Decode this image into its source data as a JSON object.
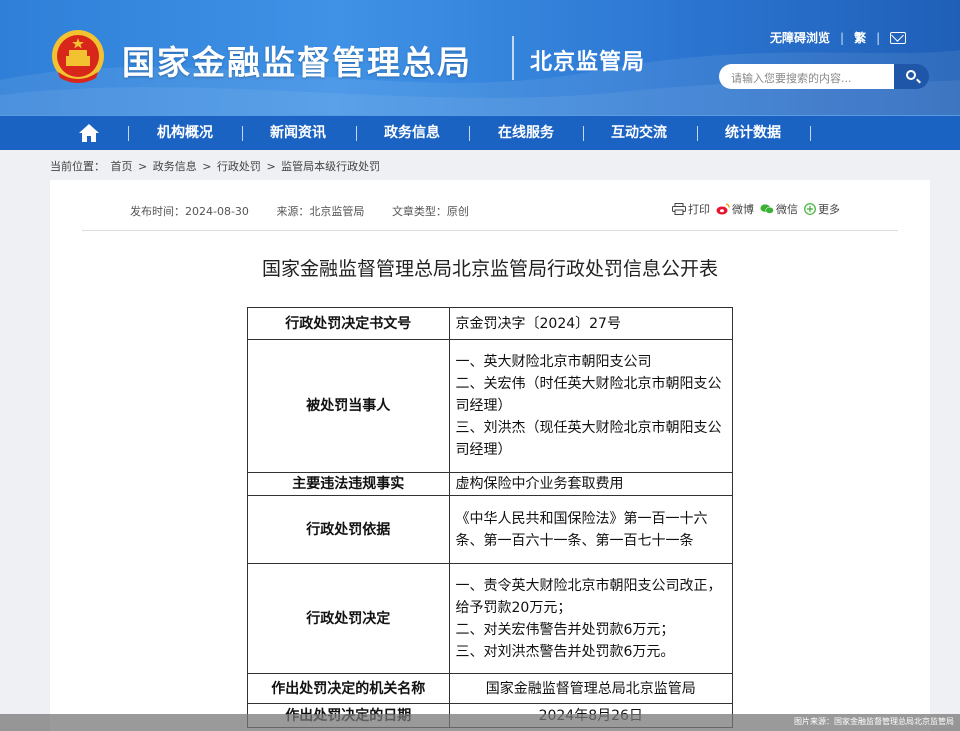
{
  "header": {
    "site_title": "国家金融监督管理总局",
    "branch_title": "北京监管局",
    "accessibility": "无障碍浏览",
    "traditional": "繁",
    "search_placeholder": "请输入您要搜索的内容..."
  },
  "nav": {
    "items": [
      {
        "label": "机构概况"
      },
      {
        "label": "新闻资讯"
      },
      {
        "label": "政务信息"
      },
      {
        "label": "在线服务"
      },
      {
        "label": "互动交流"
      },
      {
        "label": "统计数据"
      }
    ]
  },
  "breadcrumb": {
    "prefix": "当前位置：",
    "items": [
      "首页",
      "政务信息",
      "行政处罚",
      "监管局本级行政处罚"
    ],
    "separator": ">"
  },
  "article": {
    "publish_time": "发布时间：2024-08-30",
    "source": "来源：北京监管局",
    "doc_type": "文章类型：原创",
    "share": {
      "print": "打印",
      "weibo": "微博",
      "wechat": "微信",
      "more": "更多"
    },
    "title": "国家金融监督管理总局北京监管局行政处罚信息公开表"
  },
  "table": {
    "r1_k": "行政处罚决定书文号",
    "r1_v": "京金罚决字〔2024〕27号",
    "r2_k": "被处罚当事人",
    "r2_v": [
      "一、英大财险北京市朝阳支公司",
      "二、关宏伟（时任英大财险北京市朝阳支公司经理）",
      "三、刘洪杰（现任英大财险北京市朝阳支公司经理）"
    ],
    "r3_k": "主要违法违规事实",
    "r3_v": "虚构保险中介业务套取费用",
    "r4_k": "行政处罚依据",
    "r4_v": "《中华人民共和国保险法》第一百一十六条、第一百六十一条、第一百七十一条",
    "r5_k": "行政处罚决定",
    "r5_v": [
      "一、责令英大财险北京市朝阳支公司改正，给予罚款20万元；",
      "二、对关宏伟警告并处罚款6万元；",
      "三、对刘洪杰警告并处罚款6万元。"
    ],
    "r6_k": "作出处罚决定的机关名称",
    "r6_v": "国家金融监督管理总局北京监管局",
    "r7_k": "作出处罚决定的日期",
    "r7_v": "2024年8月26日"
  },
  "caption": "图片来源：国家金融监督管理总局北京监管局"
}
